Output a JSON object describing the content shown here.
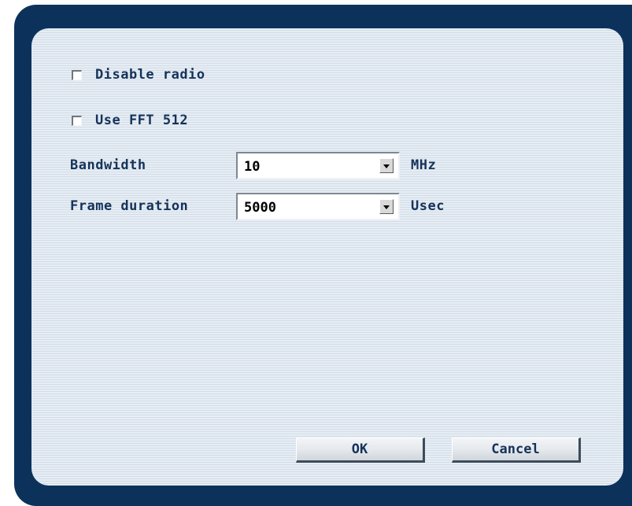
{
  "dialog": {
    "disable_radio": {
      "label": "Disable radio",
      "checked": false
    },
    "use_fft512": {
      "label": "Use FFT 512",
      "checked": false
    },
    "bandwidth": {
      "label": "Bandwidth",
      "value": "10",
      "unit": "MHz"
    },
    "frame_duration": {
      "label": "Frame duration",
      "value": "5000",
      "unit": "Usec"
    },
    "ok_label": "OK",
    "cancel_label": "Cancel"
  },
  "colors": {
    "frame": "#0c325c",
    "panel": "#dfe7ef",
    "text": "#15325a"
  }
}
